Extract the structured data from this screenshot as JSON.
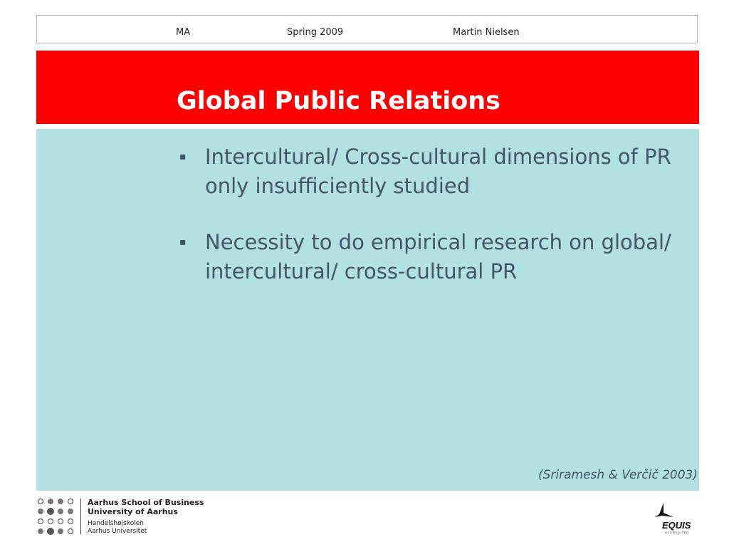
{
  "header": {
    "course": "MA",
    "term": "Spring 2009",
    "author": "Martin Nielsen"
  },
  "title": "Global Public Relations",
  "bullets": [
    {
      "marker": "▪",
      "text": "Intercultural/ Cross-cultural dimensions of PR only insufficiently studied"
    },
    {
      "marker": "▪",
      "text": "Necessity to do empirical research on global/ intercultural/ cross-cultural PR"
    }
  ],
  "citation": "(Sriramesh & Verčič 2003)",
  "footer": {
    "school_en": "Aarhus School of Business",
    "university_en": "University of Aarhus",
    "school_da": "Handelshøjskolen",
    "university_da": "Aarhus Universitet",
    "accreditation": "EQUIS",
    "accreditation_sub": "ACCREDITED"
  },
  "colors": {
    "title_bar": "#ff0000",
    "content_bg": "#b2e0e3",
    "body_text": "#44546a"
  }
}
